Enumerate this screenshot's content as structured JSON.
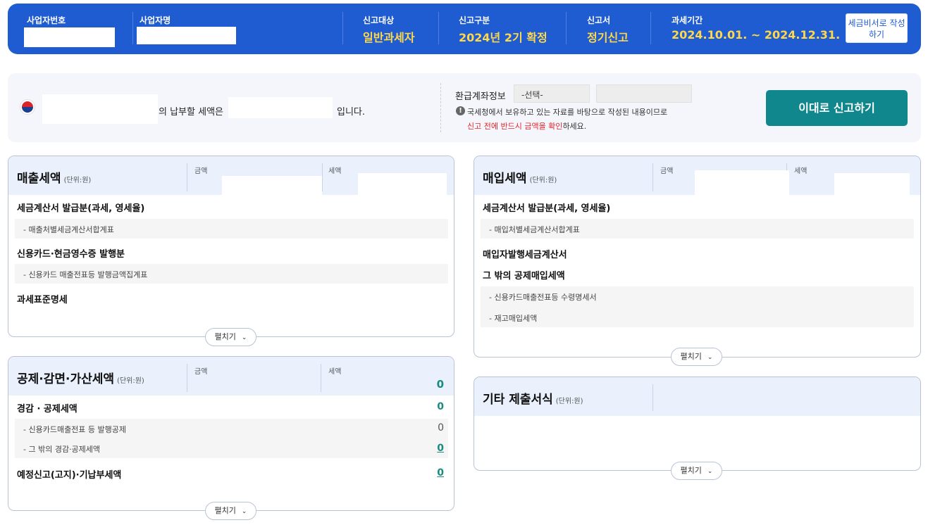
{
  "header": {
    "business_no_label": "사업자번호",
    "business_name_label": "사업자명",
    "target_label": "신고대상",
    "target_value": "일반과세자",
    "type_label": "신고구분",
    "type_value": "2024년 2기 확정",
    "form_label": "신고서",
    "form_value": "정기신고",
    "period_label": "과세기간",
    "period_value": "2024.10.01. ~ 2024.12.31.",
    "write_btn": "세금비서로 작성하기"
  },
  "summary": {
    "tax_due_prefix": "의 납부할 세액은",
    "tax_due_suffix": "입니다.",
    "refund_label": "환급계좌정보",
    "refund_select": "-선택-",
    "notice_1": "국세청에서 보유하고 있는 자료를 바탕으로 작성된 내용이므로",
    "notice_2_red": "신고 전에 반드시 금액을 확인",
    "notice_2_tail": "하세요.",
    "submit_btn": "이대로 신고하기"
  },
  "sales": {
    "title": "매출세액",
    "unit": "(단위:원)",
    "col_amount": "금액",
    "col_tax": "세액",
    "row1": "세금계산서 발급분(과세, 영세율)",
    "row1_sub": "- 매출처별세금계산서합계표",
    "row2": "신용카드·현금영수증 발행분",
    "row2_sub": "- 신용카드 매출전표등 발행금액집계표",
    "row3": "과세표준명세",
    "expand": "펼치기"
  },
  "purchase": {
    "title": "매입세액",
    "unit": "(단위:원)",
    "col_amount": "금액",
    "col_tax": "세액",
    "row1": "세금계산서 발급분(과세, 영세율)",
    "row1_sub": "- 매입처별세금계산서합계표",
    "row2": "매입자발행세금계산서",
    "row3": "그 밖의 공제매입세액",
    "row3_sub1": "- 신용카드매출전표등 수령명세서",
    "row3_sub2": "- 재고매입세액",
    "expand": "펼치기"
  },
  "deduction": {
    "title": "공제·감면·가산세액",
    "unit": "(단위:원)",
    "col_amount": "금액",
    "col_tax": "세액",
    "total": "0",
    "row1": "경감 · 공제세액",
    "row1_val": "0",
    "row1_sub1": "- 신용카드매출전표 등 발행공제",
    "row1_sub1_val": "0",
    "row1_sub2": "- 그 밖의 경감·공제세액",
    "row1_sub2_val": "0",
    "row2": "예정신고(고지)·기납부세액",
    "row2_val": "0",
    "expand": "펼치기"
  },
  "other": {
    "title": "기타 제출서식",
    "unit": "(단위:원)",
    "expand": "펼치기"
  }
}
